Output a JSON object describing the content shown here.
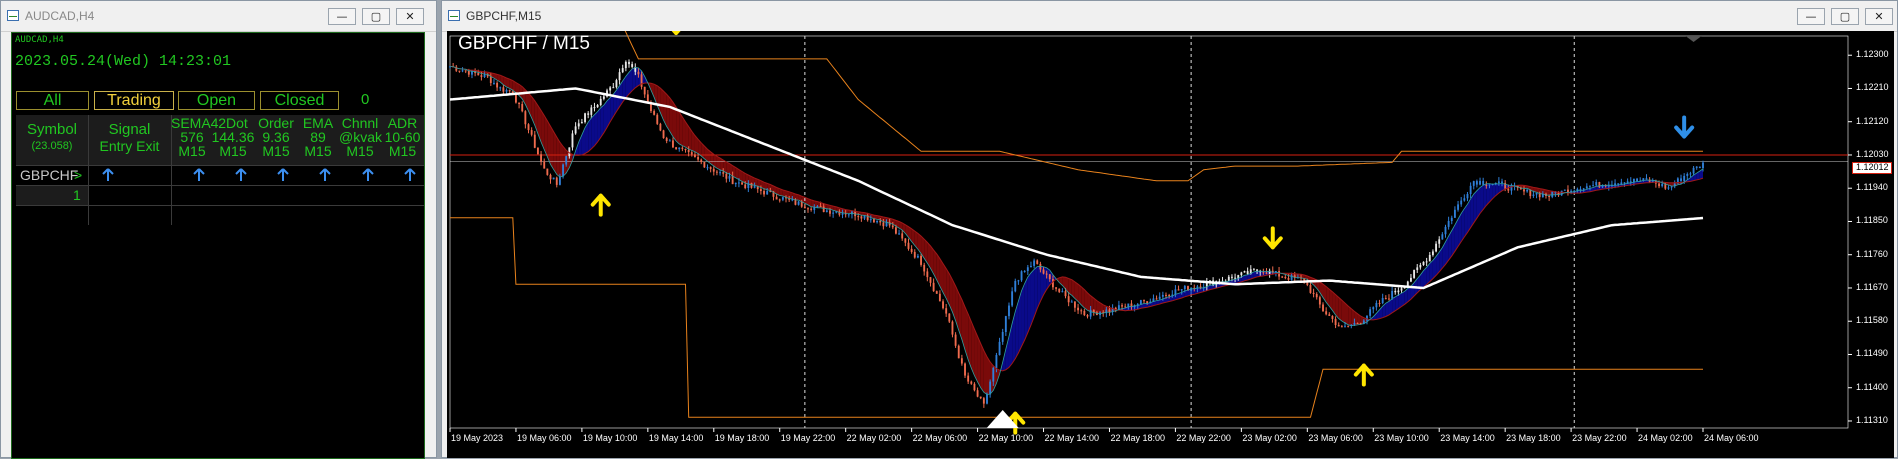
{
  "left_window": {
    "title": "AUDCAD,H4",
    "panel_label": "AUDCAD,H4",
    "datetime": "2023.05.24(Wed) 14:23:01",
    "tabs": [
      "All",
      "Trading",
      "Open",
      "Closed"
    ],
    "tab_count": "0",
    "columns": {
      "symbol": [
        "Symbol",
        "(23.058)"
      ],
      "signal": [
        "Signal",
        "Entry Exit"
      ],
      "sema4": [
        "SEMA4",
        "576",
        "M15"
      ],
      "twodot": [
        "2Dot",
        "144.36",
        "M15"
      ],
      "order": [
        "Order",
        "9.36",
        "M15"
      ],
      "ema": [
        "EMA",
        "89",
        "M15"
      ],
      "chnnl": [
        "Chnnl",
        "@kvak",
        "M15"
      ],
      "adr": [
        "ADR",
        "10-60",
        "M15"
      ]
    },
    "row": {
      "symbol": "GBPCHF",
      "marker": ">"
    },
    "row_number": "1"
  },
  "right_window": {
    "title": "GBPCHF,M15",
    "chart_title": "GBPCHF / M15",
    "current_price": "1.12012"
  },
  "window_buttons": {
    "minimize": "—",
    "maximize": "▢",
    "close": "✕"
  },
  "colors": {
    "bull": "#2f7fd8",
    "bear": "#ef6b4e",
    "white_candle": "#e8e8e8",
    "ma_white": "#ffffff",
    "channel": "#e8821c",
    "fill_bull": "#0a0a8a",
    "fill_bear": "#7a0a0a",
    "arrow": "#ffe600",
    "price_line": "#d62010"
  },
  "chart_data": {
    "type": "line",
    "title": "GBPCHF / M15",
    "y_ticks": [
      "1.12300",
      "1.12210",
      "1.12120",
      "1.12030",
      "1.11940",
      "1.11850",
      "1.11760",
      "1.11670",
      "1.11580",
      "1.11490",
      "1.11400",
      "1.11310"
    ],
    "x_ticks": [
      "19 May 2023",
      "19 May 06:00",
      "19 May 10:00",
      "19 May 14:00",
      "19 May 18:00",
      "19 May 22:00",
      "22 May 02:00",
      "22 May 06:00",
      "22 May 10:00",
      "22 May 14:00",
      "22 May 18:00",
      "22 May 22:00",
      "23 May 02:00",
      "23 May 06:00",
      "23 May 10:00",
      "23 May 14:00",
      "23 May 18:00",
      "23 May 22:00",
      "24 May 02:00",
      "24 May 06:00"
    ],
    "ylim": [
      1.11291,
      1.12352
    ],
    "price_keypoints": [
      [
        0,
        1.1227
      ],
      [
        8,
        1.1225
      ],
      [
        12,
        1.1224
      ],
      [
        16,
        1.1221
      ],
      [
        20,
        1.122
      ],
      [
        24,
        1.1212
      ],
      [
        30,
        1.1199
      ],
      [
        34,
        1.1195
      ],
      [
        40,
        1.1211
      ],
      [
        46,
        1.1216
      ],
      [
        52,
        1.1222
      ],
      [
        56,
        1.1229
      ],
      [
        60,
        1.1224
      ],
      [
        64,
        1.1215
      ],
      [
        68,
        1.1208
      ],
      [
        72,
        1.1205
      ],
      [
        80,
        1.1201
      ],
      [
        90,
        1.1196
      ],
      [
        100,
        1.1193
      ],
      [
        110,
        1.119
      ],
      [
        120,
        1.1188
      ],
      [
        130,
        1.1187
      ],
      [
        140,
        1.1184
      ],
      [
        150,
        1.1174
      ],
      [
        158,
        1.116
      ],
      [
        164,
        1.1143
      ],
      [
        170,
        1.1135
      ],
      [
        176,
        1.1155
      ],
      [
        180,
        1.1169
      ],
      [
        186,
        1.1174
      ],
      [
        194,
        1.1166
      ],
      [
        202,
        1.116
      ],
      [
        210,
        1.1161
      ],
      [
        220,
        1.1163
      ],
      [
        230,
        1.1166
      ],
      [
        240,
        1.1168
      ],
      [
        250,
        1.117
      ],
      [
        258,
        1.1172
      ],
      [
        266,
        1.117
      ],
      [
        272,
        1.1169
      ],
      [
        278,
        1.1161
      ],
      [
        284,
        1.1156
      ],
      [
        290,
        1.1158
      ],
      [
        296,
        1.1163
      ],
      [
        304,
        1.1168
      ],
      [
        312,
        1.1176
      ],
      [
        320,
        1.1188
      ],
      [
        326,
        1.1196
      ],
      [
        334,
        1.1195
      ],
      [
        342,
        1.1193
      ],
      [
        350,
        1.1192
      ],
      [
        358,
        1.1194
      ],
      [
        366,
        1.1195
      ],
      [
        374,
        1.1196
      ],
      [
        382,
        1.1196
      ],
      [
        388,
        1.1194
      ],
      [
        394,
        1.1198
      ],
      [
        400,
        1.1201
      ]
    ],
    "white_ma_keypoints": [
      [
        0,
        1.1218
      ],
      [
        40,
        1.1221
      ],
      [
        70,
        1.1216
      ],
      [
        100,
        1.1206
      ],
      [
        130,
        1.1196
      ],
      [
        160,
        1.1184
      ],
      [
        190,
        1.1176
      ],
      [
        220,
        1.117
      ],
      [
        250,
        1.1168
      ],
      [
        280,
        1.1169
      ],
      [
        310,
        1.1167
      ],
      [
        340,
        1.1178
      ],
      [
        370,
        1.1184
      ],
      [
        400,
        1.1186
      ]
    ],
    "channel_upper_keypoints": [
      [
        0,
        1.1238
      ],
      [
        55,
        1.1238
      ],
      [
        60,
        1.1229
      ],
      [
        100,
        1.1229
      ],
      [
        115,
        1.1229
      ],
      [
        120,
        1.1229
      ],
      [
        130,
        1.1218
      ],
      [
        150,
        1.1204
      ],
      [
        175,
        1.1204
      ],
      [
        200,
        1.1199
      ],
      [
        225,
        1.1196
      ],
      [
        235,
        1.1196
      ],
      [
        240,
        1.1199
      ],
      [
        250,
        1.12
      ],
      [
        270,
        1.12
      ],
      [
        300,
        1.1201
      ],
      [
        303,
        1.1204
      ],
      [
        400,
        1.1204
      ]
    ],
    "channel_lower_keypoints": [
      [
        0,
        1.1186
      ],
      [
        20,
        1.1186
      ],
      [
        21,
        1.1168
      ],
      [
        75,
        1.1168
      ],
      [
        76,
        1.1132
      ],
      [
        160,
        1.1132
      ],
      [
        175,
        1.1132
      ],
      [
        230,
        1.1132
      ],
      [
        274,
        1.1132
      ],
      [
        278,
        1.1145
      ],
      [
        300,
        1.1145
      ],
      [
        400,
        1.1145
      ]
    ],
    "current_price": 1.12012,
    "price_line_red": 1.1203,
    "vertical_gridlines_bar": [
      113,
      236,
      358
    ],
    "arrows": [
      {
        "type": "up",
        "bar": 48,
        "value": 1.1192
      },
      {
        "type": "down",
        "bar": 72,
        "value": 1.1236
      },
      {
        "type": "up",
        "bar": 180,
        "value": 1.1133
      },
      {
        "type": "down",
        "bar": 262,
        "value": 1.1178
      },
      {
        "type": "up",
        "bar": 291,
        "value": 1.1146
      },
      {
        "type": "down",
        "bar": 393,
        "value": 1.1208
      }
    ],
    "bars": 400
  }
}
